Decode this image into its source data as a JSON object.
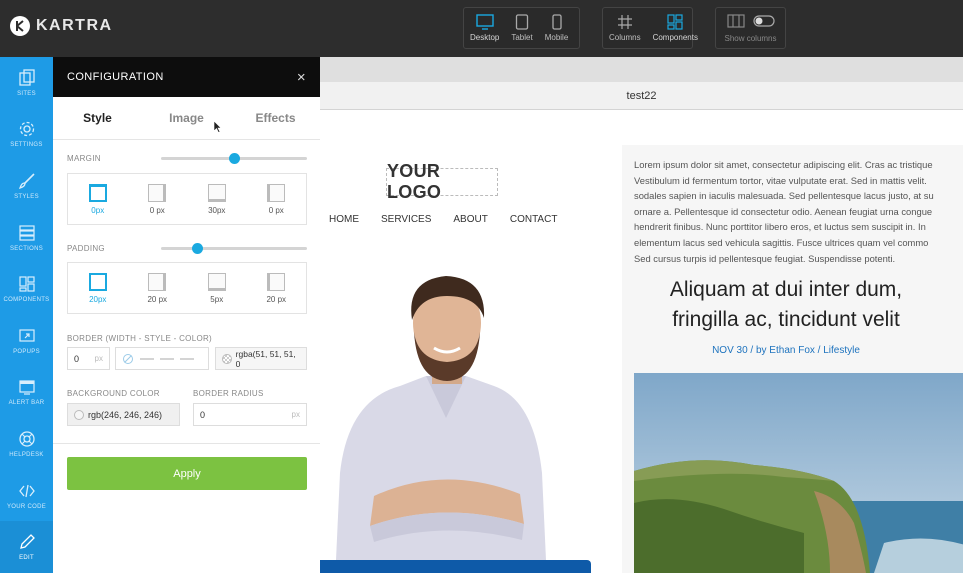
{
  "app": {
    "brand": "KARTRA"
  },
  "toolbar": {
    "devices": [
      {
        "label": "Desktop",
        "icon": "desktop-icon"
      },
      {
        "label": "Tablet",
        "icon": "tablet-icon"
      },
      {
        "label": "Mobile",
        "icon": "mobile-icon"
      }
    ],
    "grid": [
      {
        "label": "Columns",
        "icon": "columns-icon"
      },
      {
        "label": "Components",
        "icon": "components-icon"
      }
    ],
    "show_columns_label": "Show columns"
  },
  "sidebar": {
    "items": [
      {
        "label": "SITES",
        "icon": "sites-icon"
      },
      {
        "label": "SETTINGS",
        "icon": "gear-icon"
      },
      {
        "label": "STYLES",
        "icon": "brush-icon"
      },
      {
        "label": "SECTIONS",
        "icon": "sections-icon"
      },
      {
        "label": "COMPONENTS",
        "icon": "components-icon"
      },
      {
        "label": "POPUPS",
        "icon": "popup-icon"
      },
      {
        "label": "ALERT BAR",
        "icon": "alert-bar-icon"
      },
      {
        "label": "HELPDESK",
        "icon": "helpdesk-icon"
      },
      {
        "label": "YOUR CODE",
        "icon": "code-icon"
      },
      {
        "label": "EDIT",
        "icon": "pencil-icon"
      }
    ]
  },
  "config": {
    "title": "CONFIGURATION",
    "close": "×",
    "tabs": [
      "Style",
      "Image",
      "Effects"
    ],
    "margin_label": "MARGIN",
    "margin_values": [
      "0px",
      "0 px",
      "30px",
      "0 px"
    ],
    "margin_slider": 0.5,
    "padding_label": "PADDING",
    "padding_values": [
      "20px",
      "20 px",
      "5px",
      "20 px"
    ],
    "padding_slider": 0.25,
    "border_label": "BORDER (WIDTH - STYLE - COLOR)",
    "border_width": "0",
    "border_unit": "px",
    "border_color": "rgba(51, 51, 51, 0",
    "bg_label": "BACKGROUND COLOR",
    "bg_value": "rgb(246, 246, 246)",
    "radius_label": "BORDER RADIUS",
    "radius_value": "0",
    "radius_unit": "px",
    "apply": "Apply"
  },
  "canvas": {
    "page_title": "test22",
    "logo_text": "YOUR LOGO",
    "nav": [
      "HOME",
      "SERVICES",
      "ABOUT",
      "CONTACT"
    ],
    "lorem": "Lorem ipsum dolor sit amet, consectetur adipiscing elit. Cras ac tristique\nVestibulum id fermentum tortor, vitae vulputate erat. Sed in mattis velit.\nsodales sapien in iaculis malesuada. Sed pellentesque lacus justo, at su\nornare a. Pellentesque id consectetur odio. Aenean feugiat urna congue\nhendrerit finibus. Nunc porttitor libero eros, et luctus sem suscipit in. In\nelementum lacus sed vehicula sagittis. Fusce ultrices quam vel commo\nSed cursus turpis id pellentesque feugiat. Suspendisse potenti.",
    "blog_title": "Aliquam at dui inter dum, fringilla ac, tincidunt velit",
    "blog_meta": "NOV 30 / by Ethan Fox / Lifestyle"
  },
  "colors": {
    "sidebar": "#1e9be6",
    "accent": "#1aa9e0",
    "apply": "#7cc241",
    "meta_link": "#1e73be"
  }
}
